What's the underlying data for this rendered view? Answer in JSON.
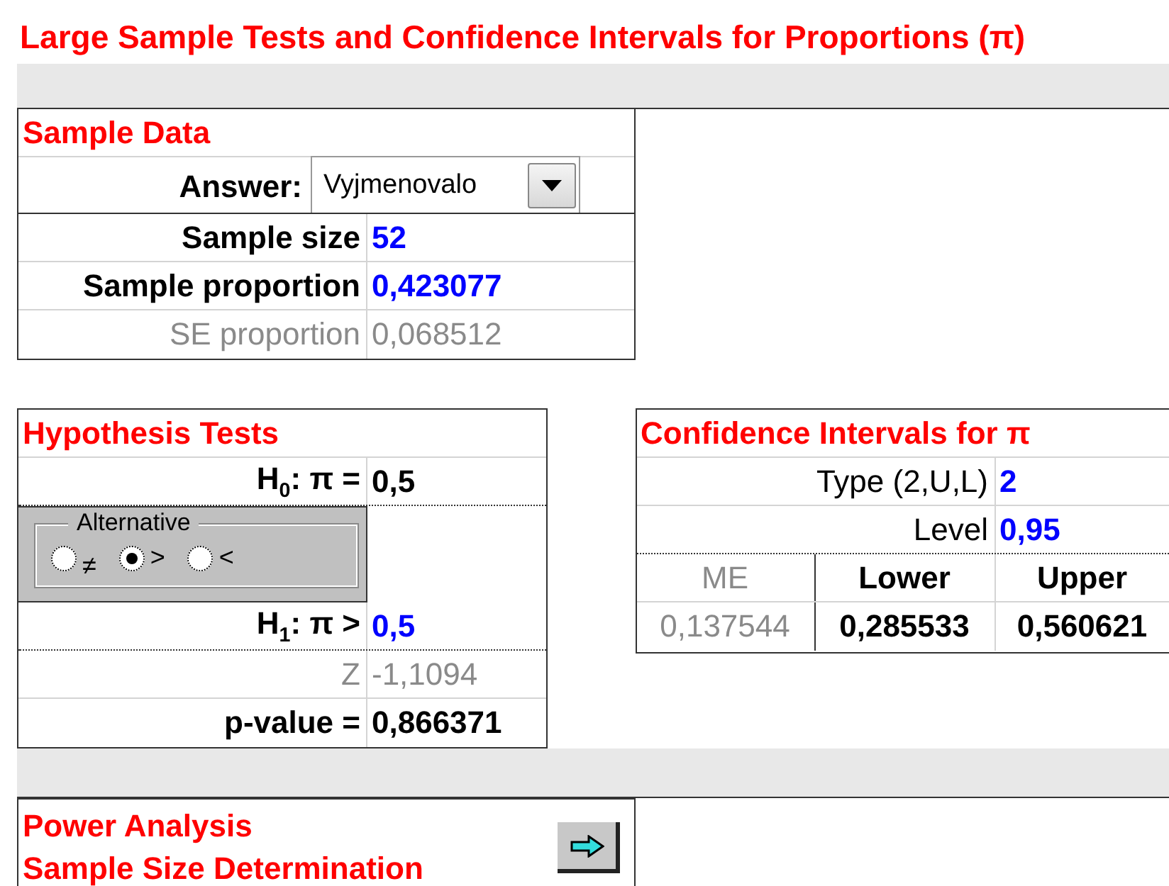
{
  "title": "Large Sample Tests and Confidence Intervals for Proportions (π)",
  "sample_data": {
    "title": "Sample Data",
    "answer": {
      "label": "Answer:",
      "value": "Vyjmenovalo"
    },
    "rows": [
      {
        "label": "Sample size",
        "value": "52",
        "kind": "input"
      },
      {
        "label": "Sample proportion",
        "value": "0,423077",
        "kind": "input"
      },
      {
        "label": "SE proportion",
        "value": "0,068512",
        "kind": "computed"
      }
    ]
  },
  "hypothesis_tests": {
    "title": "Hypothesis Tests",
    "h0": {
      "label": "H$_{0}$: π =",
      "value": "0,5",
      "kind": "result"
    },
    "alternative": {
      "legend": "Alternative",
      "options": [
        {
          "label": "≠",
          "selected": false
        },
        {
          "label": ">",
          "selected": true
        },
        {
          "label": "<",
          "selected": false
        }
      ]
    },
    "rows": [
      {
        "label": "H$_{1}$: π >",
        "value": "0,5",
        "kind": "input"
      },
      {
        "label": "Z",
        "value": "-1,1094",
        "kind": "computed"
      },
      {
        "label": "p-value =",
        "value": "0,866371",
        "kind": "result"
      }
    ]
  },
  "confidence_intervals": {
    "title": "Confidence Intervals for π",
    "rows": [
      {
        "label": "Type (2,U,L)",
        "value": "2",
        "kind": "param"
      },
      {
        "label": "Level",
        "value": "0,95",
        "kind": "param"
      }
    ],
    "columns": [
      {
        "header": "ME",
        "value": "0,137544",
        "kind": "computed"
      },
      {
        "header": "Lower",
        "value": "0,285533",
        "kind": "result"
      },
      {
        "header": "Upper",
        "value": "0,560621",
        "kind": "result"
      }
    ]
  },
  "power_analysis": {
    "title_lines": [
      "Power Analysis",
      "Sample Size Determination"
    ]
  }
}
